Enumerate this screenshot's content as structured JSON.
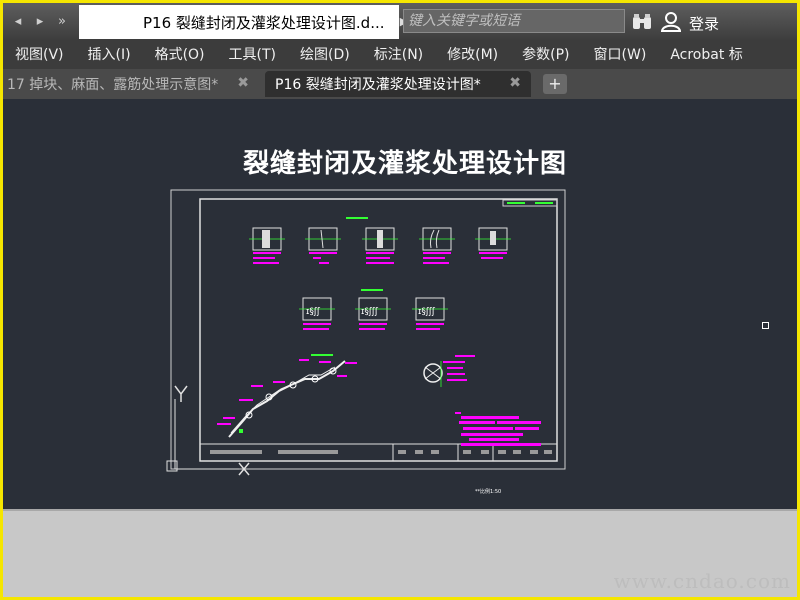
{
  "title_bar": {
    "quick_access": [
      "back",
      "forward",
      "more"
    ],
    "document_title": "P16 裂缝封闭及灌浆处理设计图.d...",
    "search_placeholder": "键入关键字或短语",
    "login_label": "登录"
  },
  "menu": {
    "items": [
      "视图(V)",
      "插入(I)",
      "格式(O)",
      "工具(T)",
      "绘图(D)",
      "标注(N)",
      "修改(M)",
      "参数(P)",
      "窗口(W)",
      "Acrobat 标"
    ]
  },
  "tabs": [
    {
      "label": "17 掉块、麻面、露筋处理示意图*",
      "active": false
    },
    {
      "label": "P16 裂缝封闭及灌浆处理设计图*",
      "active": true
    }
  ],
  "drawing": {
    "title": "裂缝封闭及灌浆处理设计图",
    "scale_note": "**比例1:50",
    "axis_y": "Y",
    "axis_x": "X"
  },
  "watermark": "www.cndao.com",
  "colors": {
    "canvas": "#2a2f38",
    "frame_line": "#d0d0d0",
    "accent_magenta": "#ff00ff",
    "accent_green": "#33ff33",
    "border_yellow": "#f5e600"
  }
}
